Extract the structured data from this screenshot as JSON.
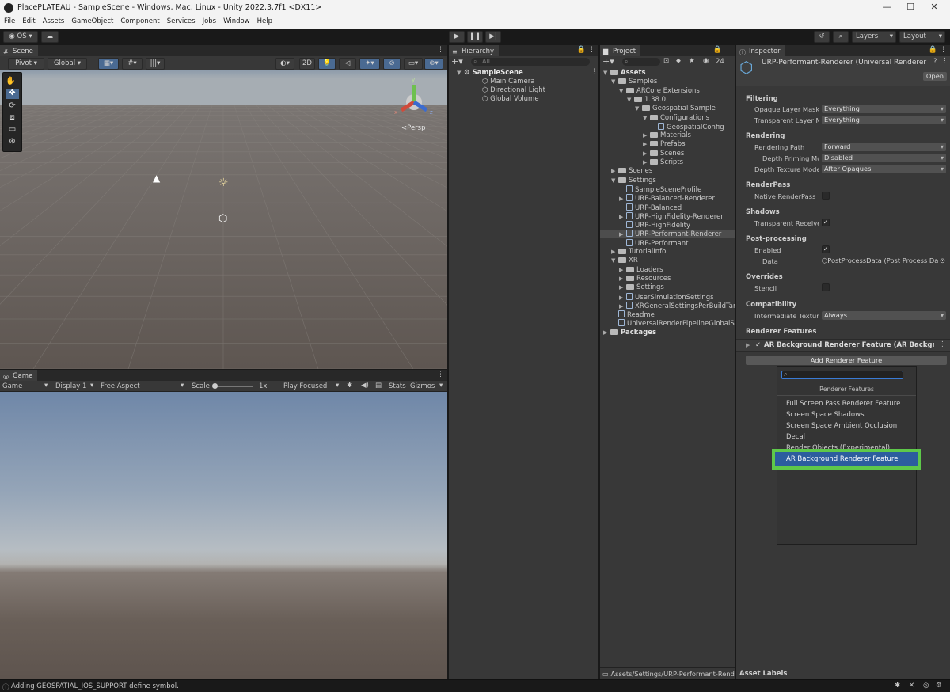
{
  "window": {
    "title": "PlacePLATEAU - SampleScene - Windows, Mac, Linux - Unity 2022.3.7f1 <DX11>"
  },
  "menu": [
    "File",
    "Edit",
    "Assets",
    "GameObject",
    "Component",
    "Services",
    "Jobs",
    "Window",
    "Help"
  ],
  "toolbar": {
    "account": "OS",
    "layers": "Layers",
    "layout": "Layout"
  },
  "scene": {
    "tab": "Scene",
    "pivot": "Pivot",
    "global": "Global",
    "twod": "2D",
    "persp": "<Persp"
  },
  "game": {
    "tab": "Game",
    "view": "Game",
    "display": "Display 1",
    "aspect": "Free Aspect",
    "scale_label": "Scale",
    "scale_value": "1x",
    "play_mode": "Play Focused",
    "stats": "Stats",
    "gizmos": "Gizmos"
  },
  "hierarchy": {
    "tab": "Hierarchy",
    "search_placeholder": "All",
    "items": [
      "SampleScene",
      "Main Camera",
      "Directional Light",
      "Global Volume"
    ]
  },
  "project": {
    "tab": "Project",
    "count": "24",
    "path": "Assets/Settings/URP-Performant-Renderer",
    "items": [
      "Assets",
      "Samples",
      "ARCore Extensions",
      "1.38.0",
      "Geospatial Sample",
      "Configurations",
      "GeospatialConfig",
      "Materials",
      "Prefabs",
      "Scenes",
      "Scripts",
      "Scenes",
      "Settings",
      "SampleSceneProfile",
      "URP-Balanced-Renderer",
      "URP-Balanced",
      "URP-HighFidelity-Renderer",
      "URP-HighFidelity",
      "URP-Performant-Renderer",
      "URP-Performant",
      "TutorialInfo",
      "XR",
      "Loaders",
      "Resources",
      "Settings",
      "UserSimulationSettings",
      "XRGeneralSettingsPerBuildTarg",
      "Readme",
      "UniversalRenderPipelineGlobalSet",
      "Packages"
    ]
  },
  "inspector": {
    "tab": "Inspector",
    "object_title": "URP-Performant-Renderer (Universal Renderer",
    "open_button": "Open",
    "filtering": "Filtering",
    "opaque_layer_mask": "Opaque Layer Mask",
    "opaque_value": "Everything",
    "transparent_layer_mask": "Transparent Layer M",
    "transparent_value": "Everything",
    "rendering": "Rendering",
    "rendering_path": "Rendering Path",
    "rendering_path_value": "Forward",
    "depth_priming": "Depth Priming Mo",
    "depth_priming_value": "Disabled",
    "depth_texture_mode": "Depth Texture Mode",
    "depth_texture_value": "After Opaques",
    "renderpass": "RenderPass",
    "native_renderpass": "Native RenderPass",
    "shadows": "Shadows",
    "transparent_receive": "Transparent Receive",
    "post_processing": "Post-processing",
    "enabled": "Enabled",
    "data": "Data",
    "data_value": "PostProcessData (Post Process Da",
    "overrides": "Overrides",
    "stencil": "Stencil",
    "compatibility": "Compatibility",
    "intermediate_texture": "Intermediate Texture",
    "intermediate_value": "Always",
    "renderer_features": "Renderer Features",
    "feature_item": "AR Background Renderer Feature (AR Backgroun",
    "add_feature_button": "Add Renderer Feature",
    "asset_labels": "Asset Labels"
  },
  "popup": {
    "header": "Renderer Features",
    "items": [
      "Full Screen Pass Renderer Feature",
      "Screen Space Shadows",
      "Screen Space Ambient Occlusion",
      "Decal",
      "Render Objects (Experimental)"
    ],
    "selected": "AR Background Renderer Feature",
    "highlight_color": "#5ec84a",
    "selection_color": "#2c5d9e"
  },
  "statusbar": {
    "message": "Adding GEOSPATIAL_IOS_SUPPORT define symbol."
  }
}
